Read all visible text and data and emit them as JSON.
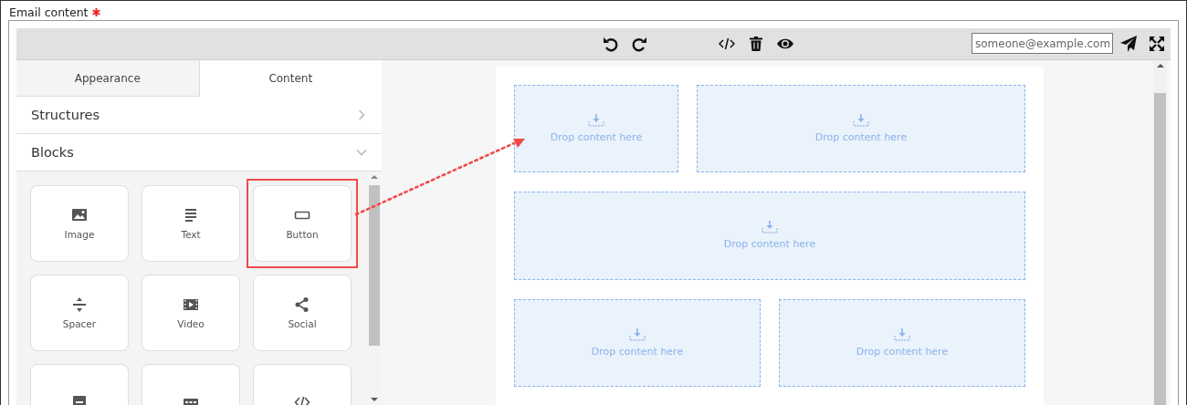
{
  "field_label": {
    "text": "Email content",
    "required": true
  },
  "toolbar": {
    "email_placeholder": "someone@example.com"
  },
  "tabs": [
    {
      "label": "Appearance",
      "selected": false
    },
    {
      "label": "Content",
      "selected": true
    }
  ],
  "sections": [
    {
      "title": "Structures",
      "expanded": false
    },
    {
      "title": "Blocks",
      "expanded": true
    }
  ],
  "blocks": [
    {
      "kind": "image",
      "label": "Image",
      "highlighted": false
    },
    {
      "kind": "text",
      "label": "Text",
      "highlighted": false
    },
    {
      "kind": "button",
      "label": "Button",
      "highlighted": true
    },
    {
      "kind": "spacer",
      "label": "Spacer",
      "highlighted": false
    },
    {
      "kind": "video",
      "label": "Video",
      "highlighted": false
    },
    {
      "kind": "social",
      "label": "Social",
      "highlighted": false
    },
    {
      "kind": "banner",
      "highlighted": false
    },
    {
      "kind": "menu",
      "highlighted": false
    },
    {
      "kind": "html",
      "highlighted": false
    }
  ],
  "drop_rows": [
    {
      "zones": [
        "Drop content here",
        "Drop content here"
      ]
    },
    {
      "zones": [
        "Drop content here"
      ]
    },
    {
      "zones": [
        "Drop content here",
        "Drop content here"
      ]
    }
  ]
}
